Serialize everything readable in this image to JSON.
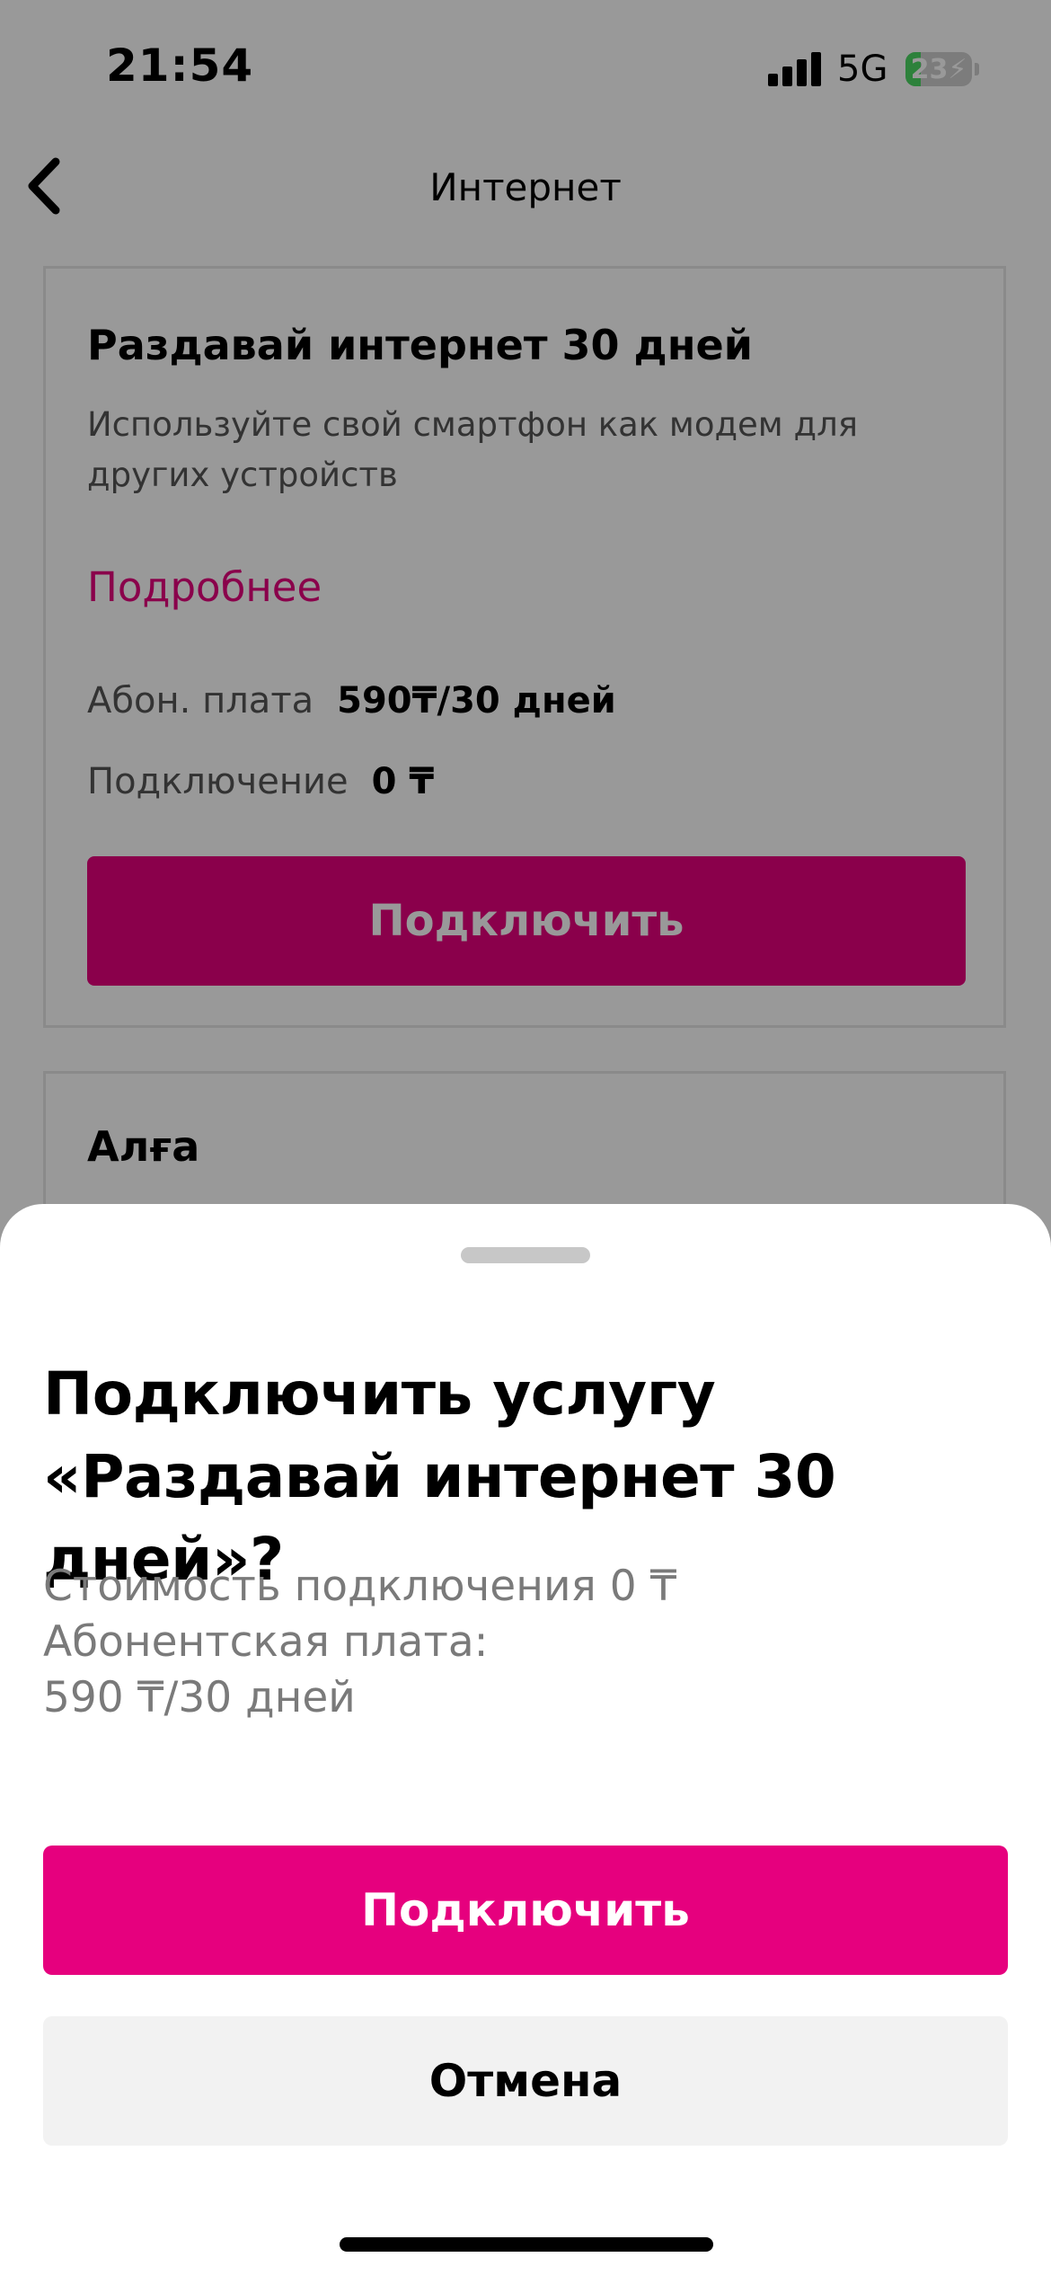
{
  "status_bar": {
    "time": "21:54",
    "network": "5G",
    "battery": "23",
    "battery_level": 0.23
  },
  "nav": {
    "title": "Интернет"
  },
  "offer": {
    "title": "Раздавай интернет 30 дней",
    "description": "Используйте свой смартфон как модем для других устройств",
    "more_link": "Подробнее",
    "fee_label": "Абон. плата",
    "fee_value": "590₸/30 дней",
    "connection_label": "Подключение",
    "connection_value": "0 ₸",
    "connect_button": "Подключить"
  },
  "next_offer": {
    "title": "Алға"
  },
  "sheet": {
    "title": "Подключить услугу «Раздавай интернет 30 дней»?",
    "line1": "Стоимость подключения 0 ₸",
    "line2": "Абонентская плата:",
    "line3": "590 ₸/30 дней",
    "confirm_button": "Подключить",
    "cancel_button": "Отмена"
  },
  "colors": {
    "accent": "#e6007e",
    "cancel_bg": "#f2f2f2",
    "overlay": "rgba(0,0,0,0.4)"
  }
}
